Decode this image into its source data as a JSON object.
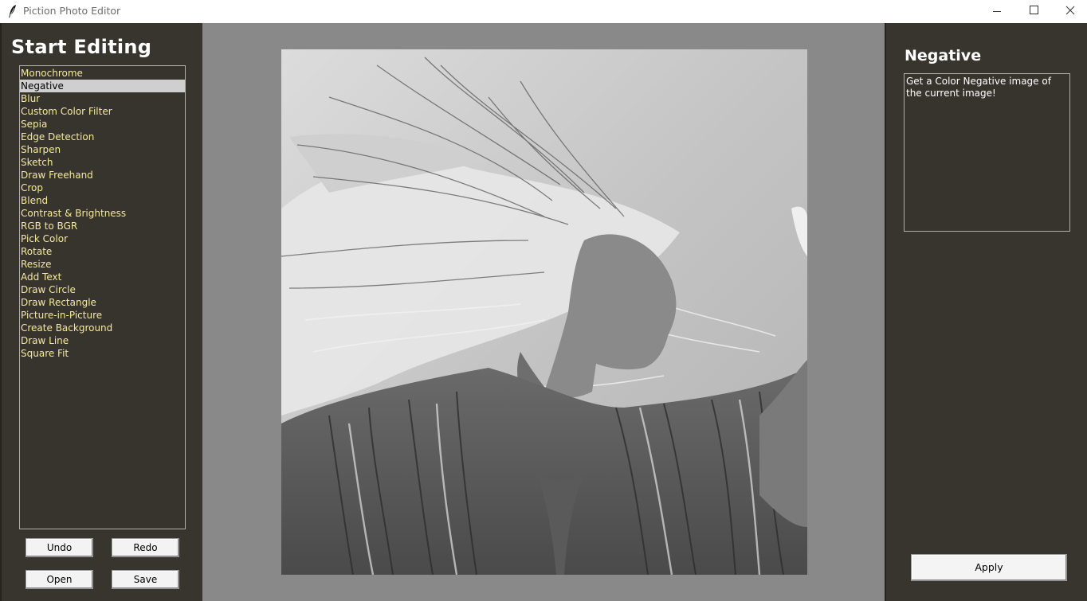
{
  "window": {
    "title": "Piction Photo Editor",
    "controls": [
      "minimize",
      "maximize",
      "close"
    ]
  },
  "left_panel": {
    "title": "Start Editing",
    "tools": [
      "Monochrome",
      "Negative",
      "Blur",
      "Custom Color Filter",
      "Sepia",
      "Edge Detection",
      "Sharpen",
      "Sketch",
      "Draw Freehand",
      "Crop",
      "Blend",
      "Contrast & Brightness",
      "RGB to BGR",
      "Pick Color",
      "Rotate",
      "Resize",
      "Add Text",
      "Draw Circle",
      "Draw Rectangle",
      "Picture-in-Picture",
      "Create Background",
      "Draw Line",
      "Square Fit"
    ],
    "selected_tool": "Negative",
    "buttons": {
      "undo": "Undo",
      "redo": "Redo",
      "open": "Open",
      "save": "Save"
    }
  },
  "right_panel": {
    "filter_name": "Negative",
    "description": "Get a Color Negative image of the current image!",
    "apply_label": "Apply"
  },
  "colors": {
    "panel_bg": "#38352f",
    "canvas_bg": "#898989",
    "list_text": "#f5e99a",
    "selected_bg": "#cfcfcf"
  }
}
